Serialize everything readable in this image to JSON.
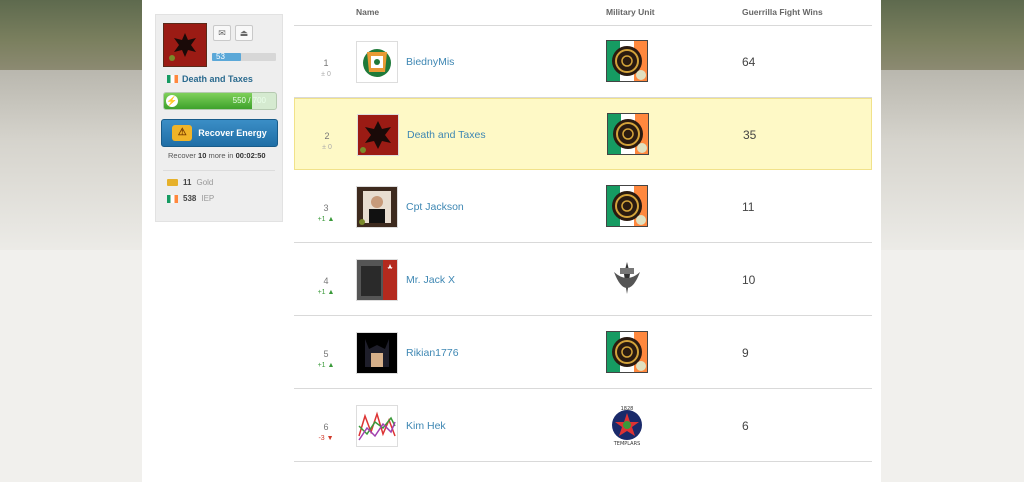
{
  "sidebar": {
    "xp_level": "53",
    "xp_progress": 0.45,
    "player_name": "Death and Taxes",
    "energy_text": "550 / 700",
    "energy_fraction": 0.7857,
    "recover_label": "Recover Energy",
    "recover_prefix": "Recover",
    "recover_amount": "10",
    "recover_mid": "more in",
    "recover_time": "00:02:50",
    "gold_amount": "11",
    "gold_label": "Gold",
    "iep_amount": "538",
    "iep_label": "IEP"
  },
  "table": {
    "headers": {
      "name": "Name",
      "unit": "Military Unit",
      "wins": "Guerrilla Fight Wins"
    },
    "rows": [
      {
        "rank": "1",
        "change": "± 0",
        "change_type": "same",
        "name": "BiednyMis",
        "wins": "64",
        "avatar": "crest",
        "unit_icon": "celtic"
      },
      {
        "rank": "2",
        "change": "± 0",
        "change_type": "same",
        "name": "Death and Taxes",
        "wins": "35",
        "avatar": "horde",
        "unit_icon": "celtic",
        "highlight": true
      },
      {
        "rank": "3",
        "change": "+1",
        "change_type": "up",
        "name": "Cpt Jackson",
        "wins": "11",
        "avatar": "portrait",
        "unit_icon": "celtic"
      },
      {
        "rank": "4",
        "change": "+1",
        "change_type": "up",
        "name": "Mr. Jack X",
        "wins": "10",
        "avatar": "dark",
        "unit_icon": "dagger"
      },
      {
        "rank": "5",
        "change": "+1",
        "change_type": "up",
        "name": "Rikian1776",
        "wins": "9",
        "avatar": "batman",
        "unit_icon": "celtic"
      },
      {
        "rank": "6",
        "change": "-3",
        "change_type": "down",
        "name": "Kim Hek",
        "wins": "6",
        "avatar": "graph",
        "unit_icon": "templars"
      }
    ]
  },
  "colors": {
    "link": "#3e87b3",
    "highlight": "#fef9c6",
    "up": "#3a9a3a",
    "down": "#d03a2a"
  }
}
